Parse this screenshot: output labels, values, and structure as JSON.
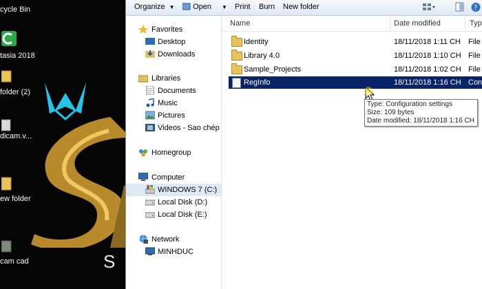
{
  "desktop": {
    "items": [
      {
        "label": "cycle Bin"
      },
      {
        "label": "tasia 2018"
      },
      {
        "label": "folder (2)"
      },
      {
        "label": "dicam.v..."
      },
      {
        "label": "ew folder"
      },
      {
        "label": "cam cad"
      }
    ],
    "brand_letter": "S"
  },
  "toolbar": {
    "organize": "Organize",
    "open": "Open",
    "print": "Print",
    "burn": "Burn",
    "new_folder": "New folder"
  },
  "nav": {
    "favorites": "Favorites",
    "desktop": "Desktop",
    "downloads": "Downloads",
    "libraries": "Libraries",
    "documents": "Documents",
    "music": "Music",
    "pictures": "Pictures",
    "videos": "Videos - Sao chép",
    "homegroup": "Homegroup",
    "computer": "Computer",
    "drive_c": "WINDOWS 7 (C:)",
    "drive_d": "Local Disk (D:)",
    "drive_e": "Local Disk (E:)",
    "network": "Network",
    "minhduc": "MINHDUC"
  },
  "columns": {
    "name": "Name",
    "date": "Date modified",
    "type": "Type"
  },
  "files": [
    {
      "name": "Identity",
      "date": "18/11/2018 1:11 CH",
      "type": "File fi"
    },
    {
      "name": "Library 4.0",
      "date": "18/11/2018 1:10 CH",
      "type": "File fi"
    },
    {
      "name": "Sample_Projects",
      "date": "18/11/2018 1:02 CH",
      "type": "File fi"
    },
    {
      "name": "RegInfo",
      "date": "18/11/2018 1:16 CH",
      "type": "Confi"
    }
  ],
  "tooltip": {
    "type": "Type: Configuration settings",
    "size": "Size: 109 bytes",
    "modified": "Date modified: 18/11/2018 1:16 CH"
  },
  "colors": {
    "selection": "#0a246a",
    "toolbar": "#dfe8f3",
    "folder": "#e8c25a"
  }
}
